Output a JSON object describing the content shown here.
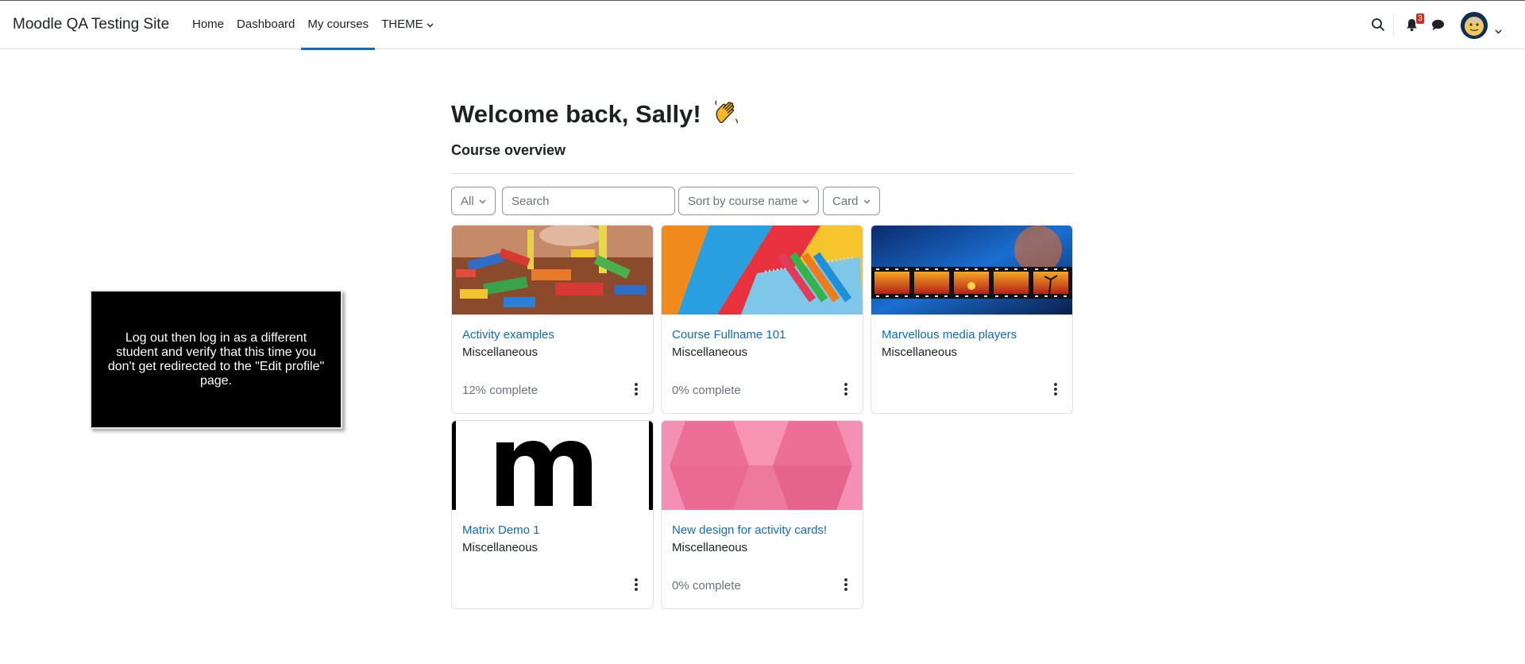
{
  "navbar": {
    "site_name": "Moodle QA Testing Site",
    "items": [
      {
        "label": "Home",
        "active": false
      },
      {
        "label": "Dashboard",
        "active": false
      },
      {
        "label": "My courses",
        "active": true
      },
      {
        "label": "THEME",
        "active": false,
        "dropdown": true
      }
    ],
    "icons": [
      "search-icon",
      "bell-icon",
      "chat-icon",
      "avatar",
      "chevron-down-icon"
    ],
    "notification_count": "3",
    "accent_color": "#0f6cbf"
  },
  "main": {
    "welcome": "Welcome back, Sally!",
    "wave_icon": "waving-hand-icon",
    "section_title": "Course overview",
    "filters": {
      "grouping": "All",
      "search_placeholder": "Search",
      "sort": "Sort by course name",
      "view": "Card"
    },
    "courses": [
      {
        "name": "Activity examples",
        "category": "Miscellaneous",
        "progress": "12% complete",
        "image": "colored-wooden-blocks"
      },
      {
        "name": "Course Fullname 101",
        "category": "Miscellaneous",
        "progress": "0% complete",
        "image": "colored-paper-and-markers"
      },
      {
        "name": "Marvellous media players",
        "category": "Miscellaneous",
        "progress": "",
        "image": "film-strip-sunsets"
      },
      {
        "name": "Matrix Demo 1",
        "category": "Miscellaneous",
        "progress": "",
        "image": "letter-m-logo"
      },
      {
        "name": "New design for activity cards!",
        "category": "Miscellaneous",
        "progress": "0% complete",
        "image": "pink-geometric-pattern"
      }
    ]
  },
  "overlay": {
    "instruction": "Log out then log in as a different student and verify that this time you don't get redirected to the \"Edit profile\" page."
  }
}
